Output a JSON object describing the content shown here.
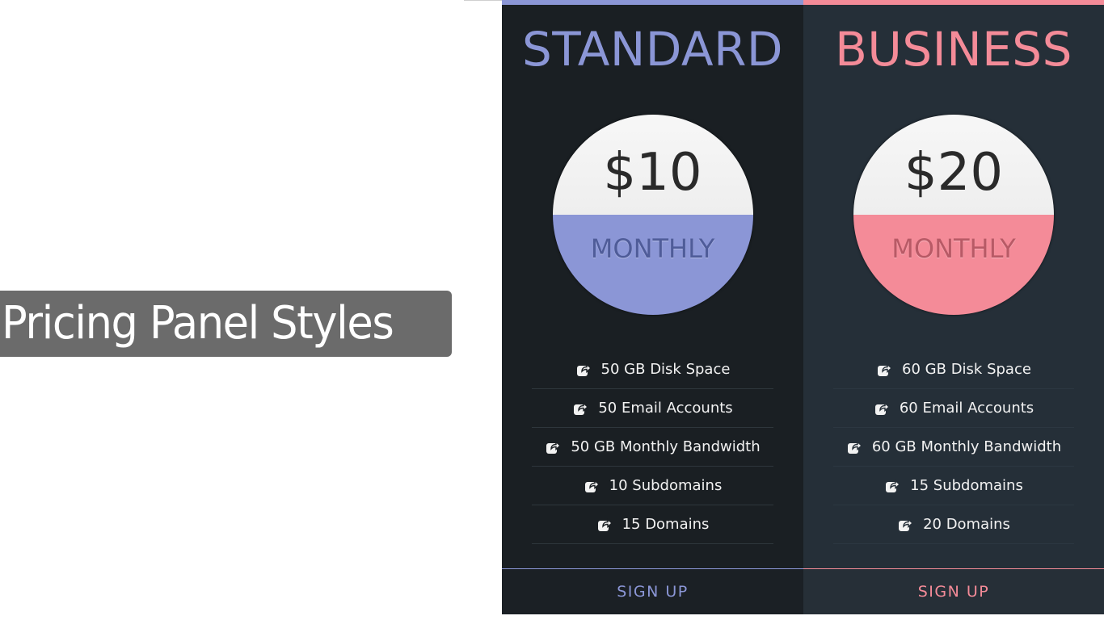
{
  "banner": {
    "title": "Pricing Panel Styles"
  },
  "plans": [
    {
      "name": "STANDARD",
      "price": "$10",
      "period": "MONTHLY",
      "accent": "#8b96d6",
      "period_color": "#4f5c99",
      "divider": "#2e363c",
      "features": [
        "50 GB Disk Space",
        "50 Email Accounts",
        "50 GB Monthly Bandwidth",
        "10 Subdomains",
        "15 Domains"
      ],
      "cta": "SIGN UP"
    },
    {
      "name": "BUSINESS",
      "price": "$20",
      "period": "MONTHLY",
      "accent": "#f48b98",
      "period_color": "#b85a66",
      "divider": "#2c3741",
      "features": [
        "60 GB Disk Space",
        "60 Email Accounts",
        "60 GB Monthly Bandwidth",
        "15 Subdomains",
        "20 Domains"
      ],
      "cta": "SIGN UP"
    }
  ],
  "icons": {
    "feature": "share-icon"
  }
}
